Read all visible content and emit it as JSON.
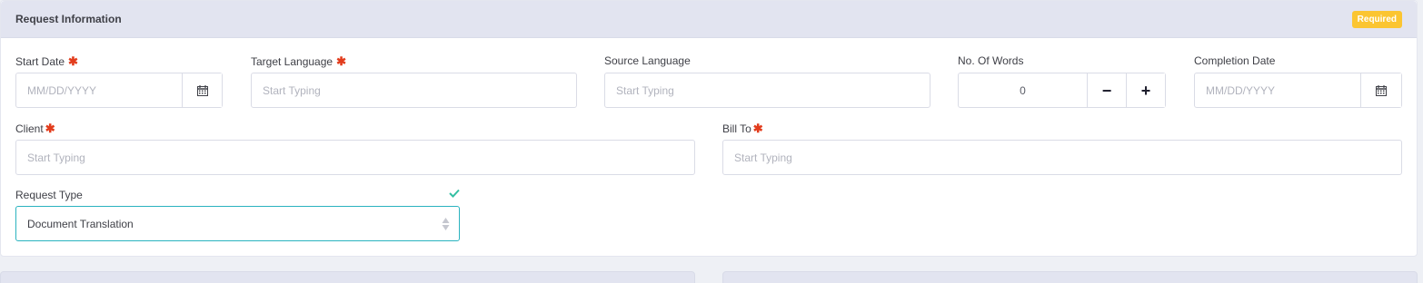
{
  "panel": {
    "title": "Request Information",
    "badge": "Required"
  },
  "fields": {
    "start_date": {
      "label": "Start Date",
      "required_mark": "✱",
      "placeholder": "MM/DD/YYYY"
    },
    "target_language": {
      "label": "Target Language",
      "required_mark": "✱",
      "placeholder": "Start Typing"
    },
    "source_language": {
      "label": "Source Language",
      "placeholder": "Start Typing"
    },
    "words": {
      "label": "No. Of Words",
      "value": "0",
      "minus": "−",
      "plus": "+"
    },
    "completion_date": {
      "label": "Completion Date",
      "placeholder": "MM/DD/YYYY"
    },
    "client": {
      "label": "Client",
      "required_mark": "✱",
      "placeholder": "Start Typing"
    },
    "bill_to": {
      "label": "Bill To",
      "required_mark": "✱",
      "placeholder": "Start Typing"
    },
    "request_type": {
      "label": "Request Type",
      "value": "Document Translation",
      "valid_icon": "check-icon"
    }
  },
  "colors": {
    "accent": "#2ab3bf",
    "required": "#e23c1c",
    "badge": "#fbc531",
    "valid": "#34bfa3"
  }
}
